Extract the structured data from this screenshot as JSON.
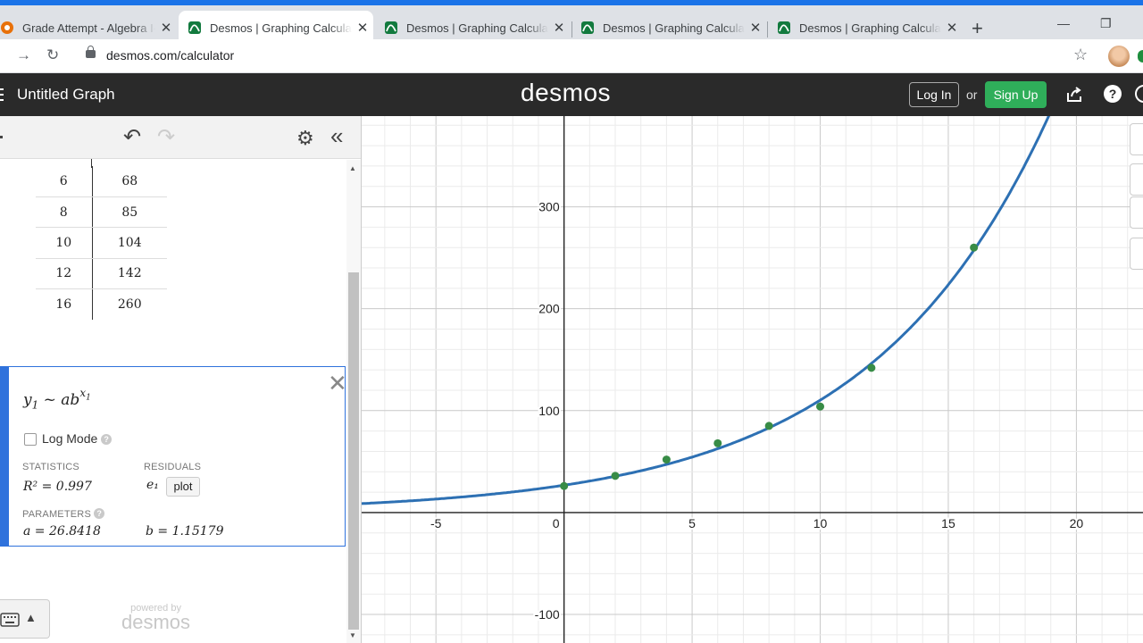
{
  "browser": {
    "tabs": [
      {
        "title": "Grade Attempt - Algebra I-A",
        "active": false
      },
      {
        "title": "Desmos | Graphing Calculator",
        "active": true
      },
      {
        "title": "Desmos | Graphing Calculator",
        "active": false
      },
      {
        "title": "Desmos | Graphing Calculator",
        "active": false
      },
      {
        "title": "Desmos | Graphing Calculator",
        "active": false
      }
    ],
    "url": "desmos.com/calculator"
  },
  "header": {
    "graph_title": "Untitled Graph",
    "logo": "desmos",
    "login": "Log In",
    "or": "or",
    "signup": "Sign Up",
    "help": "?"
  },
  "table": {
    "x1": [
      "6",
      "8",
      "10",
      "12",
      "16"
    ],
    "y1": [
      "68",
      "85",
      "104",
      "142",
      "260"
    ]
  },
  "regression": {
    "formula_y": "y",
    "formula_sub": "1",
    "formula_mid": " ~ ab",
    "formula_exp": "x",
    "formula_exp_sub": "1",
    "log_mode": "Log Mode",
    "statistics_label": "STATISTICS",
    "residuals_label": "RESIDUALS",
    "r2": "R² = 0.997",
    "residual_var": "e₁",
    "plot_button": "plot",
    "parameters_label": "PARAMETERS",
    "a": "a = 26.8418",
    "b": "b = 1.15179"
  },
  "footer": {
    "powered_by": "powered by",
    "brand": "desmos"
  },
  "chart_data": {
    "type": "scatter",
    "x_ticks": [
      "-5",
      "0",
      "5",
      "10",
      "15",
      "20"
    ],
    "y_ticks": [
      "300",
      "200",
      "100",
      "-100"
    ],
    "xlim": [
      -7.9,
      22.6
    ],
    "ylim": [
      -128,
      389
    ],
    "grid": true,
    "series": [
      {
        "points": [
          [
            0,
            26
          ],
          [
            2,
            36
          ],
          [
            4,
            52
          ],
          [
            6,
            68
          ],
          [
            8,
            85
          ],
          [
            10,
            104
          ],
          [
            12,
            142
          ],
          [
            16,
            260
          ]
        ],
        "color": "#388c46"
      }
    ],
    "curve": {
      "a": 26.8418,
      "b": 1.15179,
      "color": "#2d70b3"
    }
  }
}
